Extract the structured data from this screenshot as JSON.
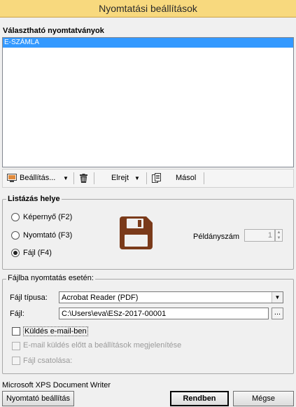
{
  "window": {
    "title": "Nyomtatási beállítások"
  },
  "forms": {
    "label": "Választható nyomtatványok",
    "items": [
      {
        "label": "E-SZÁMLA",
        "selected": true
      }
    ]
  },
  "toolbar": {
    "settings_label": "Beállítás...",
    "hide_label": "Elrejt",
    "copy_label": "Másol"
  },
  "output": {
    "group_label": "Listázás helye",
    "options": [
      {
        "label": "Képernyő (F2)",
        "selected": false
      },
      {
        "label": "Nyomtató (F3)",
        "selected": false
      },
      {
        "label": "Fájl (F4)",
        "selected": true
      }
    ],
    "copies_label": "Példányszám",
    "copies_value": "1"
  },
  "file_print": {
    "group_label": "Fájlba nyomtatás esetén:",
    "type_label": "Fájl típusa:",
    "type_value": "Acrobat Reader (PDF)",
    "file_label": "Fájl:",
    "file_value": "C:\\Users\\eva\\ESz-2017-00001",
    "browse_label": "...",
    "send_email_label": "Küldés e-mail-ben",
    "show_settings_label": "E-mail küldés előtt a beállítások megjelenítése",
    "attach_label": "Fájl csatolása:"
  },
  "footer": {
    "printer_name": "Microsoft XPS Document Writer",
    "printer_settings_label": "Nyomtató beállítás",
    "ok_label": "Rendben",
    "cancel_label": "Mégse"
  },
  "colors": {
    "title_bg": "#f8d97e",
    "selection": "#3399ff",
    "disk_icon": "#7a3a1a"
  }
}
